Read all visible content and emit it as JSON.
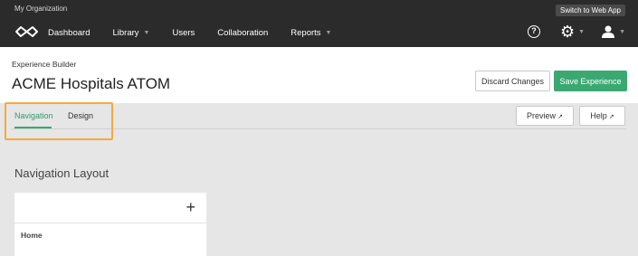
{
  "topbar": {
    "org": "My Organization",
    "switch_label": "Switch to Web App",
    "nav": [
      {
        "label": "Dashboard",
        "has_caret": false
      },
      {
        "label": "Library",
        "has_caret": true
      },
      {
        "label": "Users",
        "has_caret": false
      },
      {
        "label": "Collaboration",
        "has_caret": false
      },
      {
        "label": "Reports",
        "has_caret": true
      }
    ],
    "help_glyph": "?"
  },
  "header": {
    "breadcrumb": "Experience Builder",
    "title": "ACME Hospitals ATOM",
    "discard_label": "Discard Changes",
    "save_label": "Save Experience"
  },
  "tabs": {
    "navigation": "Navigation",
    "design": "Design",
    "active": "Navigation",
    "preview_label": "Preview",
    "help_label": "Help"
  },
  "content": {
    "section_title": "Navigation Layout",
    "add_glyph": "+",
    "items": [
      "Home"
    ]
  },
  "colors": {
    "accent": "#3ba872",
    "topbar": "#2b2b2b",
    "highlight": "#f5a940"
  }
}
